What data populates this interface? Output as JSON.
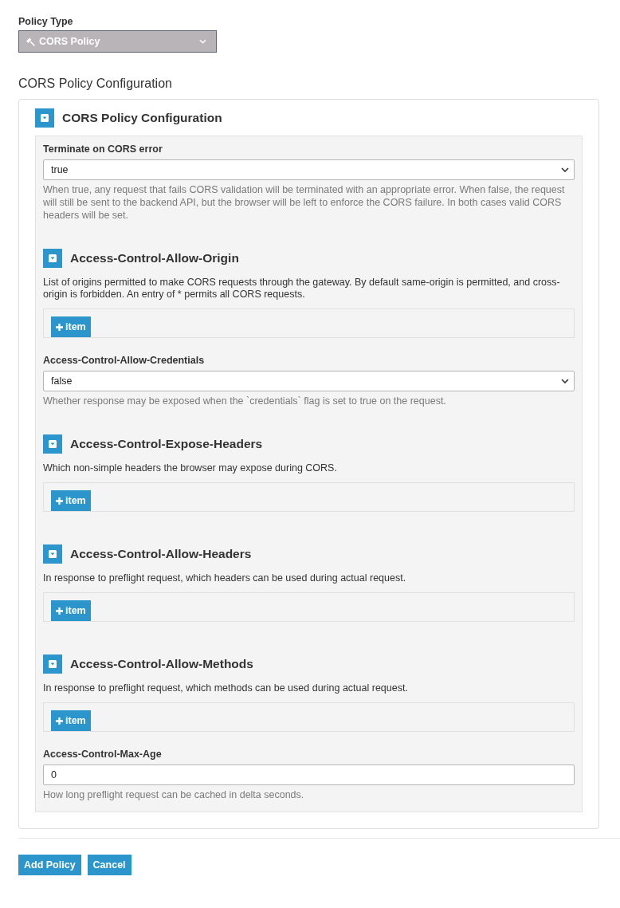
{
  "policy_type": {
    "label": "Policy Type",
    "value": "CORS Policy",
    "disabled": true
  },
  "heading": "CORS Policy Configuration",
  "config": {
    "title": "CORS Policy Configuration",
    "expanded": true,
    "fields": [
      {
        "kind": "select",
        "label": "Terminate on CORS error",
        "value": "true",
        "help": "When true, any request that fails CORS validation will be terminated with an appropriate error. When false, the request will still be sent to the backend API, but the browser will be left to enforce the CORS failure. In both cases valid CORS headers will be set."
      },
      {
        "kind": "array",
        "title": "Access-Control-Allow-Origin",
        "expanded": true,
        "description": "List of origins permitted to make CORS requests through the gateway. By default same-origin is permitted, and cross-origin is forbidden. An entry of * permits all CORS requests.",
        "button": "item"
      },
      {
        "kind": "select",
        "label": "Access-Control-Allow-Credentials",
        "value": "false",
        "help": "Whether response may be exposed when the `credentials` flag is set to true on the request."
      },
      {
        "kind": "array",
        "title": "Access-Control-Expose-Headers",
        "expanded": true,
        "description": "Which non-simple headers the browser may expose during CORS.",
        "button": "item"
      },
      {
        "kind": "array",
        "title": "Access-Control-Allow-Headers",
        "expanded": true,
        "description": "In response to preflight request, which headers can be used during actual request.",
        "button": "item"
      },
      {
        "kind": "array",
        "title": "Access-Control-Allow-Methods",
        "expanded": true,
        "description": "In response to preflight request, which methods can be used during actual request.",
        "button": "item"
      },
      {
        "kind": "input",
        "label": "Access-Control-Max-Age",
        "value": "0",
        "help": "How long preflight request can be cached in delta seconds."
      }
    ]
  },
  "actions": [
    {
      "label": "Add Policy"
    },
    {
      "label": "Cancel"
    }
  ]
}
